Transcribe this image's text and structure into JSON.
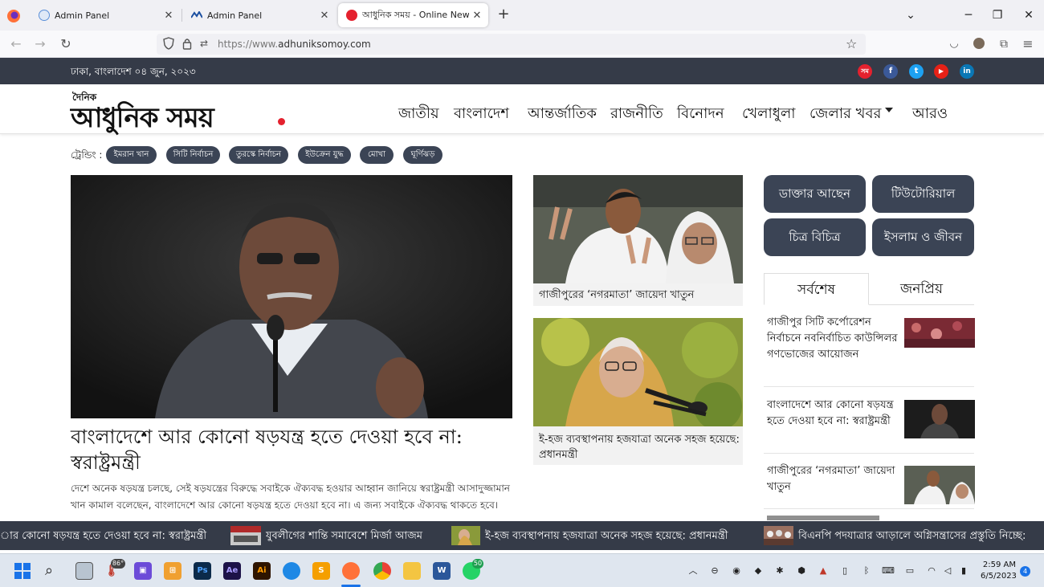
{
  "browser": {
    "tabs": [
      {
        "title": "Admin Panel",
        "active": false
      },
      {
        "title": "Admin Panel",
        "active": false
      },
      {
        "title": "আধুনিক সময় - Online Newspaper",
        "active": true
      }
    ],
    "new_tab": "+",
    "url_prefix": "https://www.",
    "url_domain": "adhuniksomoy.com"
  },
  "site": {
    "date": "ঢাকা, বাংলাদেশ ০৪ জুন, ২০২৩",
    "logo_small": "দৈনিক",
    "logo_big": "আধুনিক সময়",
    "menu": [
      "জাতীয়",
      "বাংলাদেশ",
      "আন্তর্জাতিক",
      "রাজনীতি",
      "বিনোদন",
      "খেলাধুলা",
      "জেলার খবর",
      "আরও"
    ],
    "social": [
      {
        "icon": "news-icon",
        "color": "#e4212e",
        "label": "সম"
      },
      {
        "icon": "facebook-icon",
        "color": "#3b5998",
        "label": "f"
      },
      {
        "icon": "twitter-icon",
        "color": "#1da1f2",
        "label": "t"
      },
      {
        "icon": "youtube-icon",
        "color": "#e62117",
        "label": "▶"
      },
      {
        "icon": "linkedin-icon",
        "color": "#0a77b5",
        "label": "in"
      }
    ]
  },
  "trending": {
    "label": "ট্রেন্ডিং :",
    "tags": [
      "ইমরান খান",
      "সিটি নির্বাচন",
      "তুরস্কে নির্বাচন",
      "ইউক্রেন যুদ্ধ",
      "মোখা",
      "ঘূর্ণিঝড়"
    ]
  },
  "lead": {
    "title": "বাংলাদেশে আর কোনো ষড়যন্ত্র হতে দেওয়া হবে না: স্বরাষ্ট্রমন্ত্রী",
    "summary": "দেশে অনেক ষড়যন্ত্র চলছে, সেই ষড়যন্ত্রের বিরুদ্ধে সবাইকে ঐক্যবদ্ধ হওয়ার আহ্বান জানিয়ে স্বরাষ্ট্রমন্ত্রী আসাদুজ্জামান খান কামাল বলেছেন, বাংলাদেশে আর কোনো ষড়যন্ত্র হতে দেওয়া হবে না। এ জন্য সবাইকে ঐক্যবদ্ধ থাকতে হবে।"
  },
  "mid_stories": [
    {
      "caption": "গাজীপুরের ‘নগরমাতা’ জায়েদা খাতুন"
    },
    {
      "caption": "ই-হজ ব্যবস্থাপনায় হজযাত্রা অনেক সহজ হয়েছে: প্রধানমন্ত্রী"
    }
  ],
  "categories": [
    "ডাক্তার আছেন",
    "টিউটোরিয়াল",
    "চিত্র বিচিত্র",
    "ইসলাম ও জীবন"
  ],
  "right_tabs": [
    "সর্বশেষ",
    "জনপ্রিয়"
  ],
  "latest": [
    {
      "title": "গাজীপুর সিটি কর্পোরেশন নির্বাচনে নবনির্বাচিত কাউন্সিলর গণভোজের আয়োজন"
    },
    {
      "title": "বাংলাদেশে আর কোনো ষড়যন্ত্র হতে দেওয়া হবে না: স্বরাষ্ট্রমন্ত্রী"
    },
    {
      "title": "গাজীপুরের ‘নগরমাতা’ জায়েদা খাতুন"
    }
  ],
  "ticker": [
    "ার কোনো ষড়যন্ত্র হতে দেওয়া হবে না: স্বরাষ্ট্রমন্ত্রী",
    "যুবলীগের শান্তি সমাবেশে মির্জা আজম",
    "ই-হজ ব্যবস্থাপনায় হজযাত্রা অনেক সহজ হয়েছে: প্রধানমন্ত্রী",
    "বিএনপি পদযাত্রার আড়ালে অগ্নিসন্ত্রাসের প্রস্তুতি নিচ্ছে:"
  ],
  "taskbar": {
    "weather_badge": "86°",
    "whatsapp_badge": "50",
    "time": "2:59 AM",
    "date": "6/5/2023",
    "notifications": "4"
  }
}
